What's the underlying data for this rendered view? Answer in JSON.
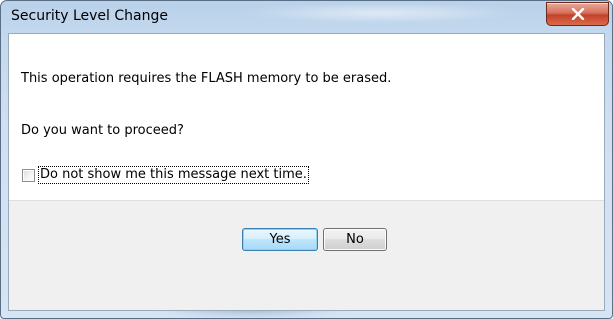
{
  "window": {
    "title": "Security Level Change",
    "close_icon": "close-x-icon"
  },
  "message": {
    "line1": "This operation requires the FLASH memory to be erased.",
    "line2": "Do you want to proceed?"
  },
  "checkbox": {
    "label": "Do not show me this message next time.",
    "checked": false
  },
  "buttons": {
    "yes_label": "Yes",
    "no_label": "No",
    "default": "yes"
  },
  "colors": {
    "close_button": "#c4412a",
    "default_button_border": "#3c7fb1",
    "content_background": "#ffffff",
    "button_area_background": "#f0f0f0"
  }
}
